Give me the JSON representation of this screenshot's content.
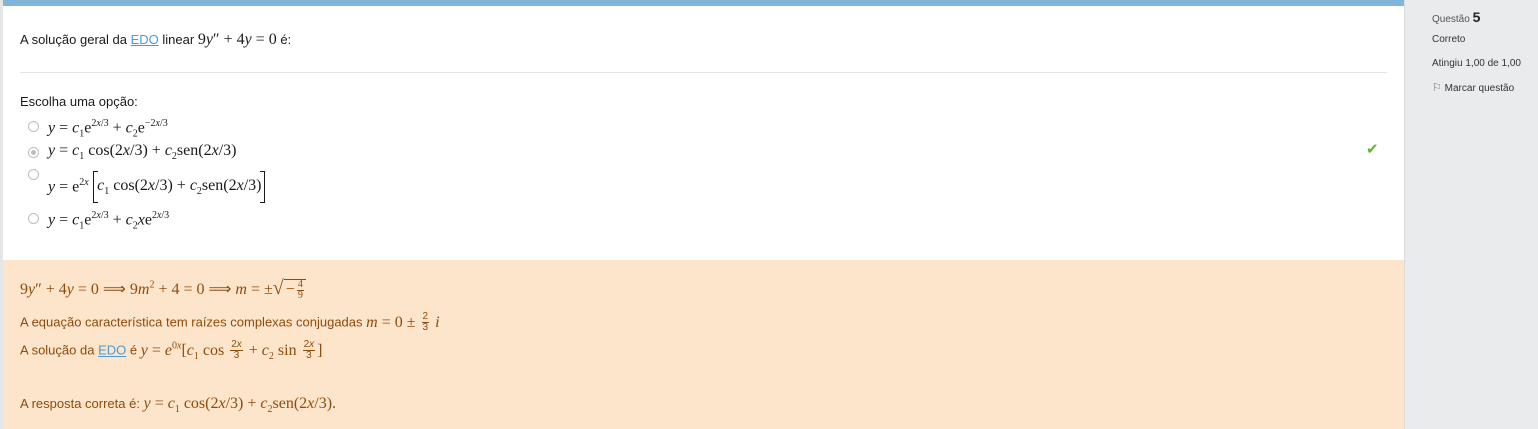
{
  "question": {
    "text_before": "A solução geral da",
    "edo_link": "EDO",
    "text_mid": "linear",
    "text_after": "é:",
    "prompt": "Escolha uma opção:",
    "options": [
      {
        "id": "a",
        "selected": false
      },
      {
        "id": "b",
        "selected": true,
        "correct": true
      },
      {
        "id": "c",
        "selected": false
      },
      {
        "id": "d",
        "selected": false
      }
    ]
  },
  "feedback": {
    "line2_text": "A equação característica tem raízes complexas conjugadas",
    "line3_text": "A solução da",
    "line3_link": "EDO",
    "line3_after": "é",
    "answer_text": "A resposta correta é:"
  },
  "sidebar": {
    "question_label": "Questão",
    "question_number": "5",
    "status": "Correto",
    "grade": "Atingiu 1,00 de 1,00",
    "flag_label": "Marcar questão"
  },
  "colors": {
    "top_bar": "#7fb5d8",
    "feedback_bg": "#fde5cc",
    "feedback_text": "#8e4b0a",
    "check": "#5ab52f",
    "sidebar_bg": "#e9ebed",
    "link": "#4b9cd3"
  }
}
